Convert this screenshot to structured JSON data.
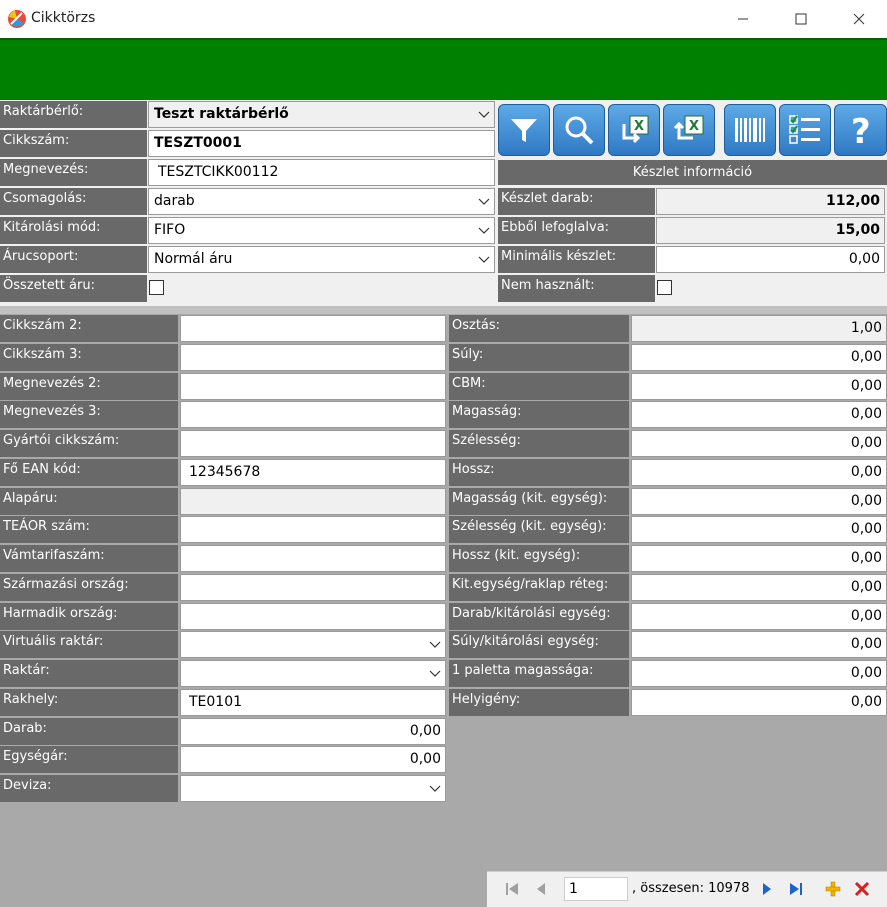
{
  "window": {
    "title": "Cikktörzs"
  },
  "top": {
    "tenant_label": "Raktárbérlő:",
    "tenant_value": "Teszt raktárbérlő",
    "sku_label": "Cikkszám:",
    "sku_value": "TESZT0001",
    "name_label": "Megnevezés:",
    "name_value": "TESZTCIKK00112",
    "pack_label": "Csomagolás:",
    "pack_value": "darab",
    "pick_label": "Kitárolási mód:",
    "pick_value": "FIFO",
    "group_label": "Árucsoport:",
    "group_value": "Normál áru",
    "composite_label": "Összetett áru:"
  },
  "toolbar": {
    "icons": [
      "filter-icon",
      "search-icon",
      "excel-import-icon",
      "excel-export-icon",
      "barcode-icon",
      "checklist-icon",
      "help-icon"
    ]
  },
  "stock": {
    "header": "Készlet információ",
    "qty_label": "Készlet darab:",
    "qty_value": "112,00",
    "reserved_label": "Ebből lefoglalva:",
    "reserved_value": "15,00",
    "min_label": "Minimális készlet:",
    "min_value": "0,00",
    "unused_label": "Nem használt:"
  },
  "left_fields": [
    {
      "label": "Cikkszám 2:",
      "value": "",
      "type": "text"
    },
    {
      "label": "Cikkszám 3:",
      "value": "",
      "type": "text"
    },
    {
      "label": "Megnevezés 2:",
      "value": "",
      "type": "text"
    },
    {
      "label": "Megnevezés 3:",
      "value": "",
      "type": "text"
    },
    {
      "label": "Gyártói cikkszám:",
      "value": "",
      "type": "text"
    },
    {
      "label": "Fő EAN kód:",
      "value": "12345678",
      "type": "text"
    },
    {
      "label": "Alapáru:",
      "value": "",
      "type": "readonly"
    },
    {
      "label": "TEÁOR szám:",
      "value": "",
      "type": "text"
    },
    {
      "label": "Vámtarifaszám:",
      "value": "",
      "type": "text"
    },
    {
      "label": "Származási ország:",
      "value": "",
      "type": "text"
    },
    {
      "label": "Harmadik ország:",
      "value": "",
      "type": "text"
    },
    {
      "label": "Virtuális raktár:",
      "value": "",
      "type": "select"
    },
    {
      "label": "Raktár:",
      "value": "",
      "type": "select"
    },
    {
      "label": "Rakhely:",
      "value": "TE0101",
      "type": "text"
    },
    {
      "label": "Darab:",
      "value": "0,00",
      "type": "number"
    },
    {
      "label": "Egységár:",
      "value": "0,00",
      "type": "number"
    },
    {
      "label": "Deviza:",
      "value": "",
      "type": "select"
    }
  ],
  "right_fields": [
    {
      "label": "Osztás:",
      "value": "1,00",
      "type": "readonly"
    },
    {
      "label": "Súly:",
      "value": "0,00",
      "type": "number"
    },
    {
      "label": "CBM:",
      "value": "0,00",
      "type": "number"
    },
    {
      "label": "Magasság:",
      "value": "0,00",
      "type": "number"
    },
    {
      "label": "Szélesség:",
      "value": "0,00",
      "type": "number"
    },
    {
      "label": "Hossz:",
      "value": "0,00",
      "type": "number"
    },
    {
      "label": "Magasság (kit. egység):",
      "value": "0,00",
      "type": "number"
    },
    {
      "label": "Szélesség (kit. egység):",
      "value": "0,00",
      "type": "number"
    },
    {
      "label": "Hossz (kit. egység):",
      "value": "0,00",
      "type": "number"
    },
    {
      "label": "Kit.egység/raklap réteg:",
      "value": "0,00",
      "type": "number"
    },
    {
      "label": "Darab/kitárolási egység:",
      "value": "0,00",
      "type": "number"
    },
    {
      "label": "Súly/kitárolási egység:",
      "value": "0,00",
      "type": "number"
    },
    {
      "label": "1 paletta magassága:",
      "value": "0,00",
      "type": "number"
    },
    {
      "label": "Helyigény:",
      "value": "0,00",
      "type": "number"
    }
  ],
  "pager": {
    "current": "1",
    "total_text": ", összesen: 10978"
  },
  "colors": {
    "header_green": "#008000",
    "label_gray": "#696969",
    "toolbar_blue": "#3b8ad6"
  }
}
